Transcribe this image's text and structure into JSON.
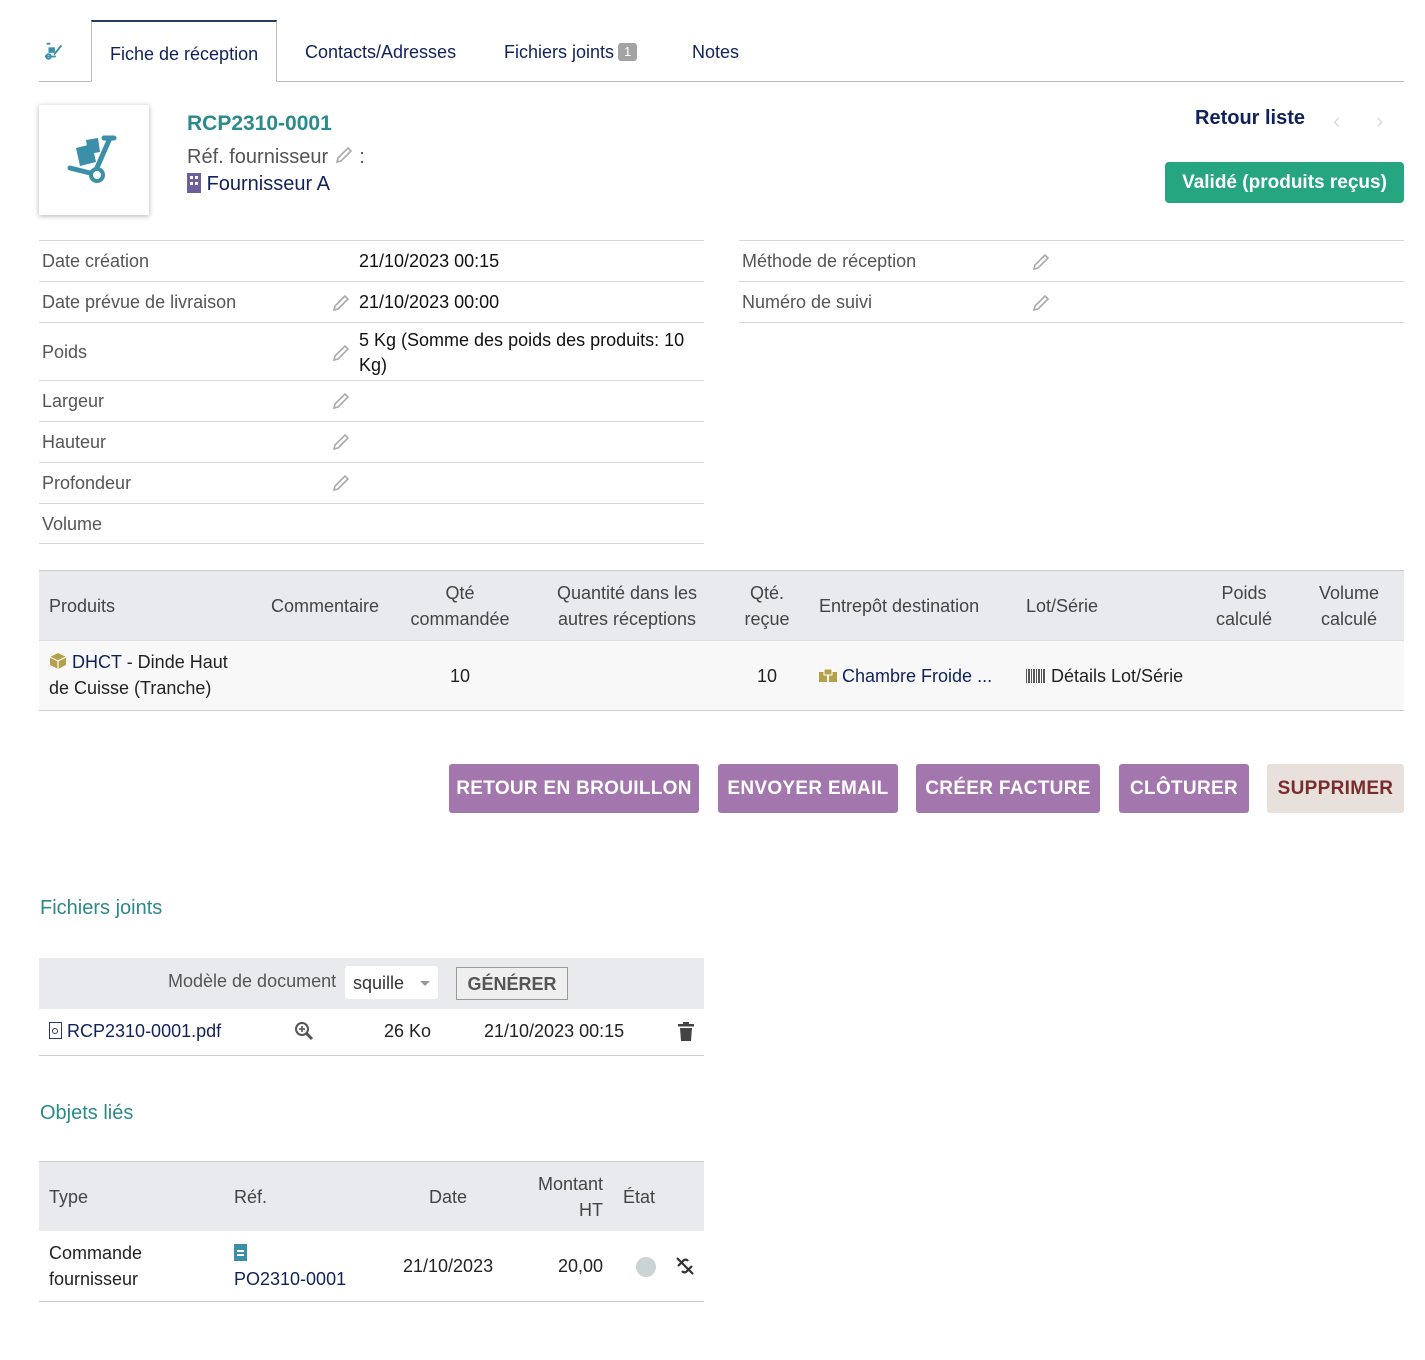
{
  "tabs": [
    {
      "label": "Fiche de réception"
    },
    {
      "label": "Contacts/Adresses"
    },
    {
      "label": "Fichiers joints",
      "badge": "1"
    },
    {
      "label": "Notes"
    }
  ],
  "header": {
    "ref": "RCP2310-0001",
    "supplier_ref_label": "Réf. fournisseur",
    "supplier_ref_sep": ":",
    "supplier_name": "Fournisseur A",
    "back_to_list": "Retour liste",
    "status": "Validé (produits reçus)"
  },
  "fields_left": [
    {
      "label": "Date création",
      "value": "21/10/2023 00:15"
    },
    {
      "label": "Date prévue de livraison",
      "value": "21/10/2023 00:00"
    },
    {
      "label": "Poids",
      "value_line1": "5 Kg (Somme des poids des produits: 10",
      "value_line2": "Kg)"
    },
    {
      "label": "Largeur",
      "value": ""
    },
    {
      "label": "Hauteur",
      "value": ""
    },
    {
      "label": "Profondeur",
      "value": ""
    },
    {
      "label": "Volume",
      "value": ""
    }
  ],
  "fields_right": [
    {
      "label": "Méthode de réception",
      "value": ""
    },
    {
      "label": "Numéro de suivi",
      "value": ""
    }
  ],
  "products": {
    "headers": {
      "produits": "Produits",
      "commentaire": "Commentaire",
      "qte_cmd_1": "Qté",
      "qte_cmd_2": "commandée",
      "autres_1": "Quantité dans les",
      "autres_2": "autres réceptions",
      "qte_recue_1": "Qté.",
      "qte_recue_2": "reçue",
      "entrepot": "Entrepôt destination",
      "lot": "Lot/Série",
      "poids_1": "Poids",
      "poids_2": "calculé",
      "volume_1": "Volume",
      "volume_2": "calculé"
    },
    "rows": [
      {
        "code": "DHCT",
        "label_1": " - Dinde Haut",
        "label_2": "de Cuisse (Tranche)",
        "qte_cmd": "10",
        "qte_recue": "10",
        "entrepot": "Chambre Froide ...",
        "lot": "Détails Lot/Série"
      }
    ]
  },
  "actions": {
    "retour_brouillon": "RETOUR EN BROUILLON",
    "envoyer_email": "ENVOYER EMAIL",
    "creer_facture": "CRÉER FACTURE",
    "cloturer": "CLÔTURER",
    "supprimer": "SUPPRIMER"
  },
  "attachments": {
    "title": "Fichiers joints",
    "model_label": "Modèle de document",
    "model_value": "squille",
    "generate": "GÉNÉRER",
    "files": [
      {
        "name": "RCP2310-0001.pdf",
        "size": "26 Ko",
        "date": "21/10/2023 00:15"
      }
    ]
  },
  "linked": {
    "title": "Objets liés",
    "headers": {
      "type": "Type",
      "ref": "Réf.",
      "date": "Date",
      "montant_1": "Montant",
      "montant_2": "HT",
      "etat": "État"
    },
    "rows": [
      {
        "type_1": "Commande",
        "type_2": "fournisseur",
        "ref": "PO2310-0001",
        "date": "21/10/2023",
        "montant": "20,00"
      }
    ]
  },
  "colors": {
    "accent_teal": "#2b8a8a",
    "status_green": "#25a580",
    "action_purple": "#a377ad",
    "link_navy": "#10225a"
  }
}
